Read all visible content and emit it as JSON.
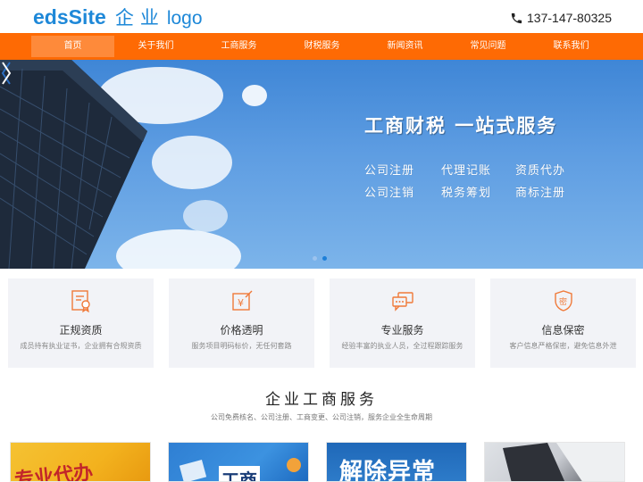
{
  "header": {
    "logo_main": "edsSite",
    "logo_cn": "企业",
    "logo_en": "logo",
    "phone": "137-147-80325",
    "phone_icon": "phone-icon"
  },
  "nav": {
    "items": [
      "首页",
      "关于我们",
      "工商服务",
      "财税服务",
      "新闻资讯",
      "常见问题",
      "联系我们"
    ],
    "active_index": 0
  },
  "banner": {
    "title": "工商财税  一站式服务",
    "items": [
      "公司注册",
      "代理记账",
      "资质代办",
      "公司注销",
      "税务筹划",
      "商标注册"
    ],
    "slide_count": 2,
    "active_slide": 1
  },
  "features": [
    {
      "icon": "certificate-icon",
      "title": "正规资质",
      "desc": "成员持有执业证书，企业拥有合规资质"
    },
    {
      "icon": "price-tag-icon",
      "title": "价格透明",
      "desc": "服务项目明码标价，无任何套路"
    },
    {
      "icon": "chat-service-icon",
      "title": "专业服务",
      "desc": "经验丰富的执业人员，全过程跟踪服务"
    },
    {
      "icon": "shield-lock-icon",
      "title": "信息保密",
      "desc": "客户信息严格保密，避免信息外泄"
    }
  ],
  "section": {
    "title": "企业工商服务",
    "subtitle": "公司免费核名、公司注册、工商变更、公司注销，服务企业全生命周期"
  },
  "thumbs": [
    {
      "text": "专业代办"
    },
    {
      "text": "工商"
    },
    {
      "text": "解除异常"
    },
    {
      "text": ""
    }
  ],
  "colors": {
    "brand_blue": "#1e88d8",
    "nav_orange": "#fe6a04",
    "icon_orange": "#f07a3a"
  }
}
